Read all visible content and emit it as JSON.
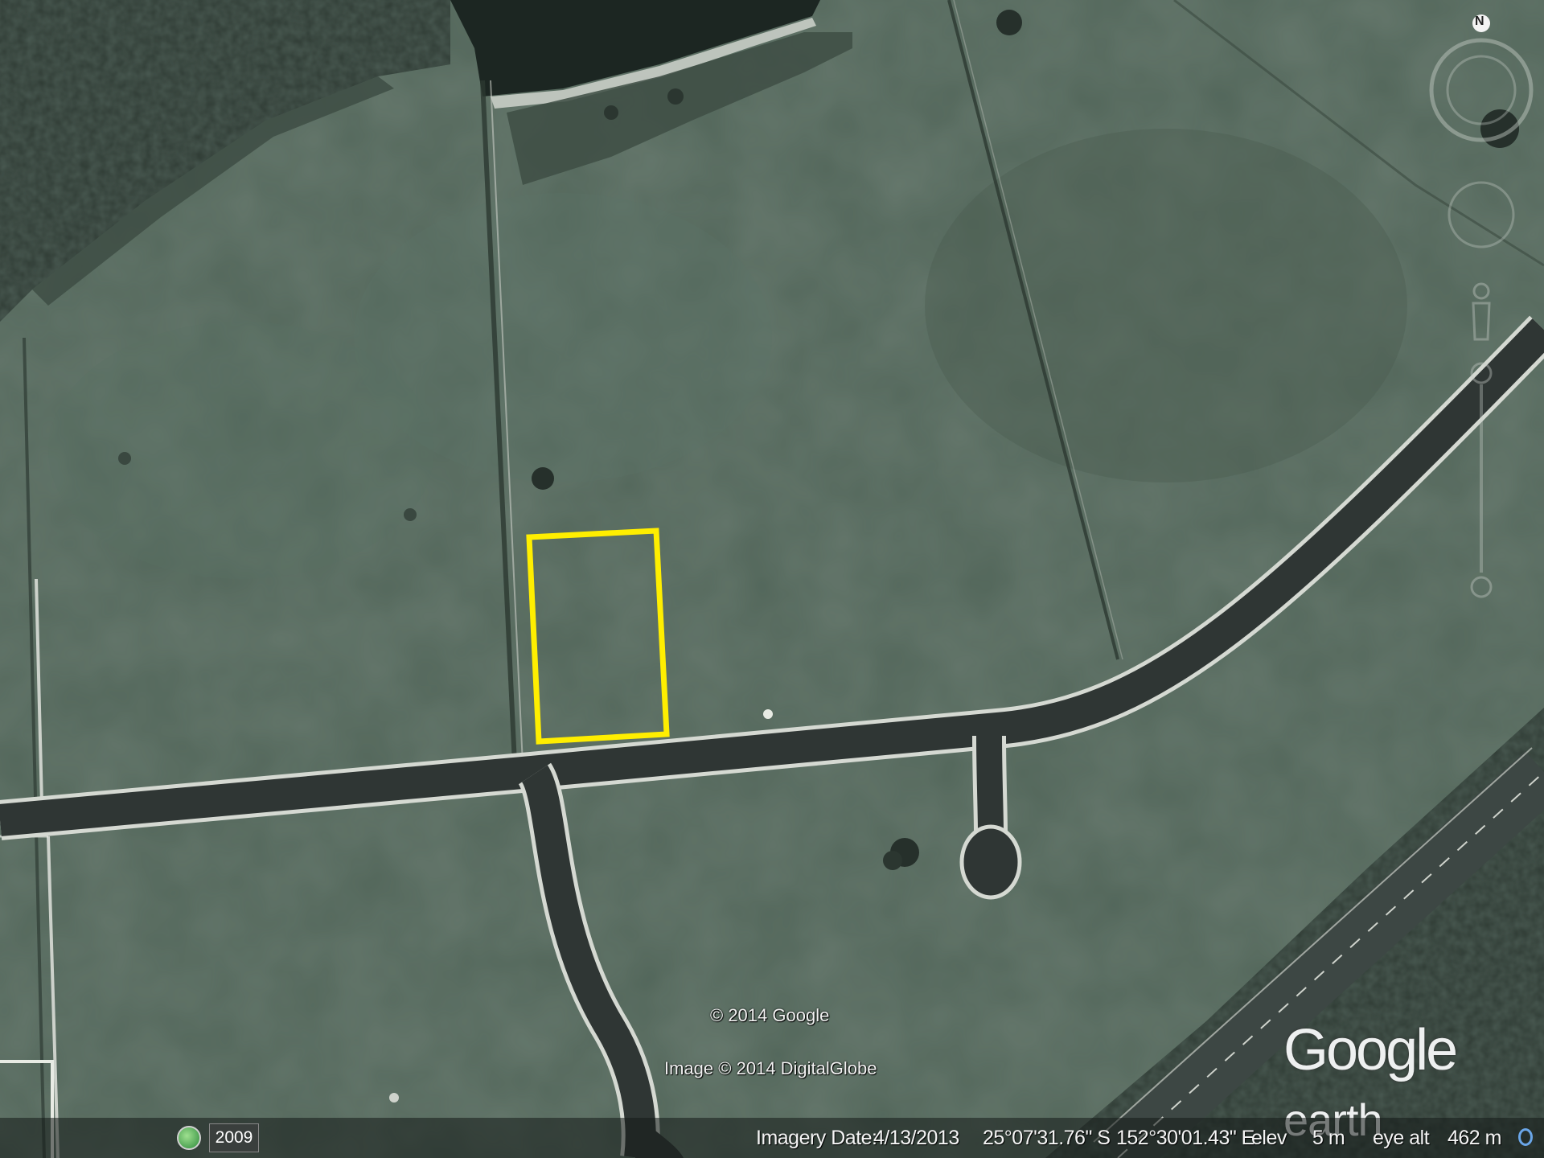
{
  "map": {
    "copyright": "© 2014 Google",
    "imagery_credit": "Image © 2014 DigitalGlobe",
    "logo": {
      "brand": "Google",
      "product": "earth"
    },
    "highlight_color": "#ffee00"
  },
  "controls": {
    "compass_label": "N",
    "historical_imagery_year": "2009",
    "icons": [
      "compass-ring-icon",
      "look-joystick-icon",
      "street-view-pegman-icon",
      "zoom-slider-icon",
      "clock-icon"
    ]
  },
  "status": {
    "imagery_date_label": "Imagery Date:",
    "imagery_date": "4/13/2013",
    "latitude": "25°07'31.76\" S",
    "longitude": "152°30'01.43\" E",
    "elev_label": "elev",
    "elev_value": "5 m",
    "eye_alt_label": "eye alt",
    "eye_alt_value": "462 m"
  }
}
